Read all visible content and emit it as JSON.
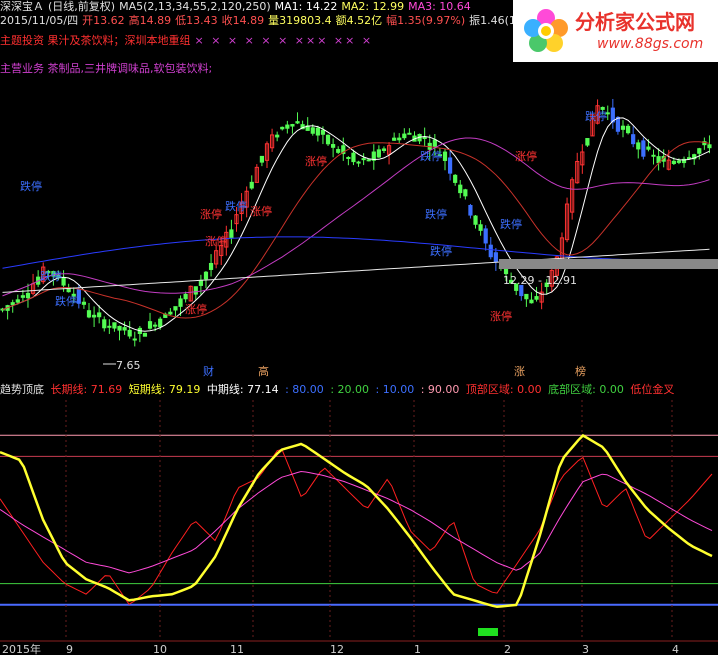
{
  "header": {
    "line1": {
      "name": "深深宝Ａ",
      "period": "(日线,前复权)",
      "ma5_label": "MA5(2,13,34,55,2,120,250)",
      "ma1": "MA1: 14.22",
      "ma2": "MA2: 12.99",
      "ma3": "MA3: 10.64"
    },
    "line2": {
      "date": "2015/11/05/四",
      "open": "开13.62",
      "high": "高14.89",
      "low": "低13.43",
      "close": "收14.89",
      "volume": "量319803.4",
      "amount": "额4.52亿",
      "change": "幅1.35(9.97%)",
      "amplitude": "振1.46(10"
    },
    "line3": "主题投资 果汁及茶饮料；深圳本地重组",
    "line3_marks": "× × ×   × × ×         ××× ×× ×",
    "line4": "主营业务 茶制品,三井牌调味品,软包装饮料;"
  },
  "logo": {
    "title": "分析家公式网",
    "url": "www.88gs.com"
  },
  "annotations": {
    "low_price": "7.65",
    "range_label": "12.29 - 12.91",
    "limit_up": "涨停",
    "limit_down": "跌停",
    "markers": [
      "财",
      "高",
      "涨",
      "榜"
    ]
  },
  "indicator_bar": {
    "title": "趋势顶底",
    "long": "长期线: 71.69",
    "short": "短期线: 79.19",
    "mid": "中期线: 77.14",
    "lv80": ": 80.00",
    "lv20": ": 20.00",
    "lv10": ": 10.00",
    "lv90": ": 90.00",
    "top_zone": "顶部区域: 0.00",
    "bottom_zone": "底部区域: 0.00",
    "low_cross": "低位金叉"
  },
  "x_axis_labels": [
    "2015年",
    "9",
    "10",
    "11",
    "12",
    "1",
    "2",
    "3",
    "4"
  ],
  "colors": {
    "up": "#ff3232",
    "down": "#3c6fff",
    "green_candle": "#54fc54",
    "ma_white": "#ffffff",
    "ma_red": "#c8322a",
    "ma_purple": "#c23cc2",
    "ma_blue": "#2a3cff",
    "long_line": "#ff2020",
    "short_line": "#ffff30",
    "mid_line": "#ff4ad8",
    "lv90": "#ff9ab0",
    "lv80": "#c83c50",
    "lv20": "#40d040",
    "lv10": "#4a6aff"
  },
  "chart_data": {
    "type": "line",
    "title": "",
    "price_panel": {
      "approx_close": [
        8.4,
        8.9,
        9.6,
        9.0,
        8.2,
        7.9,
        7.65,
        8.1,
        8.6,
        9.3,
        10.3,
        11.8,
        13.2,
        13.9,
        13.6,
        13.1,
        12.6,
        12.9,
        13.5,
        13.4,
        12.8,
        11.5,
        10.1,
        9.2,
        8.5,
        9.6,
        12.7,
        14.4,
        13.6,
        13.0,
        12.6,
        12.9,
        13.2
      ],
      "ma_lines": [
        "MA5",
        "MA1",
        "MA2",
        "MA3"
      ]
    },
    "indicator_panel": {
      "levels": [
        90,
        80,
        20,
        10
      ],
      "short_line": [
        82,
        78,
        50,
        30,
        22,
        18,
        12,
        14,
        15,
        19,
        33,
        55,
        72,
        83,
        86,
        79,
        72,
        66,
        55,
        42,
        28,
        15,
        12,
        9,
        10,
        42,
        78,
        90,
        84,
        68,
        55,
        46,
        38,
        33
      ],
      "mid_line": [
        55,
        48,
        42,
        36,
        30,
        28,
        25,
        28,
        32,
        36,
        45,
        55,
        63,
        70,
        73,
        71,
        68,
        64,
        60,
        55,
        49,
        42,
        36,
        30,
        26,
        34,
        52,
        68,
        72,
        67,
        62,
        56,
        50,
        45
      ],
      "long_line": [
        60,
        45,
        30,
        20,
        15,
        25,
        10,
        18,
        35,
        50,
        40,
        65,
        70,
        85,
        60,
        75,
        65,
        55,
        70,
        45,
        35,
        50,
        20,
        15,
        30,
        45,
        70,
        80,
        55,
        65,
        40,
        50,
        60,
        71.69
      ]
    }
  }
}
